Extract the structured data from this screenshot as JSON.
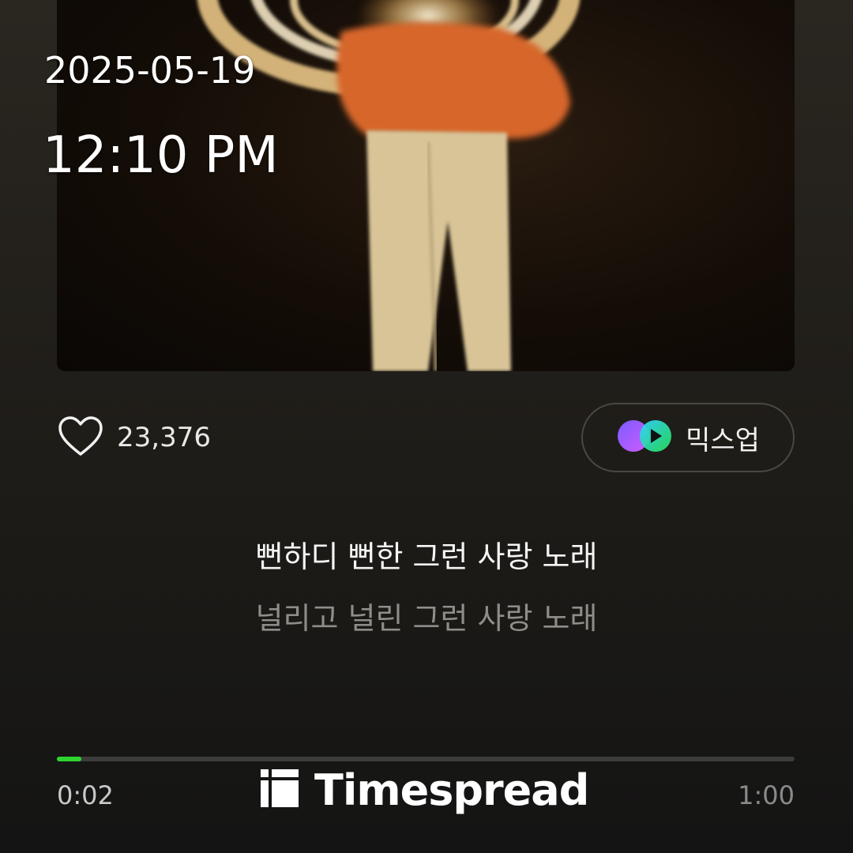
{
  "overlay": {
    "date": "2025-05-19",
    "time": "12:10 PM"
  },
  "actions": {
    "like_count": "23,376",
    "mixup_label": "믹스업"
  },
  "lyrics": {
    "current": "뻔하디 뻔한 그런 사랑 노래",
    "next": "널리고 널린 그런 사랑 노래"
  },
  "player": {
    "elapsed": "0:02",
    "total": "1:00",
    "progress_fraction": 0.033,
    "accent_color": "#2ed52e"
  },
  "watermark": {
    "text": "Timespread"
  },
  "icons": [
    "heart-icon",
    "mixup-logo-icon",
    "timespread-logo-icon"
  ]
}
